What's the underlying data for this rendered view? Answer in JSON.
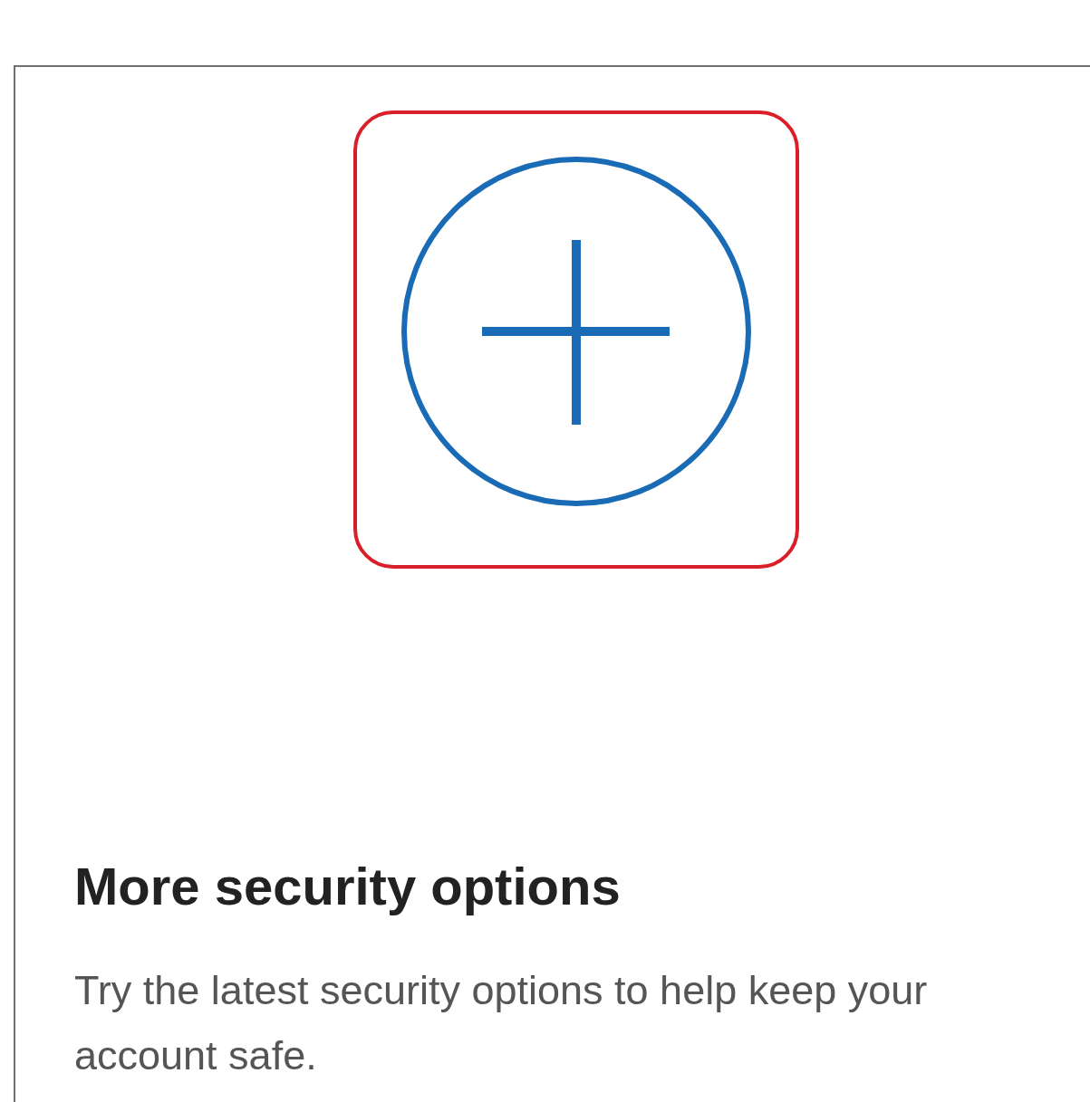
{
  "card": {
    "title": "More security options",
    "description": "Try the latest security options to help keep your account safe."
  }
}
